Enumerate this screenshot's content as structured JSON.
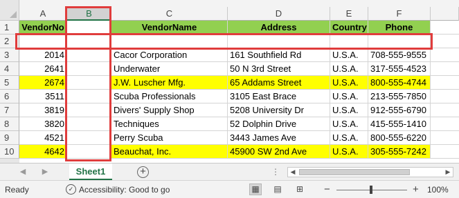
{
  "columns": [
    "A",
    "B",
    "C",
    "D",
    "E",
    "F"
  ],
  "rows": [
    "1",
    "2",
    "3",
    "4",
    "5",
    "6",
    "7",
    "8",
    "9",
    "10"
  ],
  "headers": [
    "VendorNo",
    "",
    "VendorName",
    "Address",
    "Country",
    "Phone"
  ],
  "data": [
    {
      "vendorNo": "2014",
      "name": "Cacor Corporation",
      "address": "161 Southfield Rd",
      "country": "U.S.A.",
      "phone": "708-555-9555",
      "highlight": false
    },
    {
      "vendorNo": "2641",
      "name": "Underwater",
      "address": "50 N 3rd Street",
      "country": "U.S.A.",
      "phone": "317-555-4523",
      "highlight": false
    },
    {
      "vendorNo": "2674",
      "name": "J.W.  Luscher Mfg.",
      "address": "65 Addams Street",
      "country": "U.S.A.",
      "phone": "800-555-4744",
      "highlight": true
    },
    {
      "vendorNo": "3511",
      "name": "Scuba Professionals",
      "address": "3105 East Brace",
      "country": "U.S.A.",
      "phone": "213-555-7850",
      "highlight": false
    },
    {
      "vendorNo": "3819",
      "name": "Divers'  Supply Shop",
      "address": "5208 University Dr",
      "country": "U.S.A.",
      "phone": "912-555-6790",
      "highlight": false
    },
    {
      "vendorNo": "3820",
      "name": "Techniques",
      "address": "52 Dolphin Drive",
      "country": "U.S.A.",
      "phone": "415-555-1410",
      "highlight": false
    },
    {
      "vendorNo": "4521",
      "name": "Perry Scuba",
      "address": "3443 James Ave",
      "country": "U.S.A.",
      "phone": "800-555-6220",
      "highlight": false
    },
    {
      "vendorNo": "4642",
      "name": "Beauchat, Inc.",
      "address": "45900 SW 2nd Ave",
      "country": "U.S.A.",
      "phone": "305-555-7242",
      "highlight": true
    }
  ],
  "colors": {
    "header_fill": "#92d050",
    "highlight_fill": "#ffff00",
    "annotation_box": "#e03c3c",
    "accent": "#217346"
  },
  "sheet_tab": "Sheet1",
  "status": {
    "ready": "Ready",
    "accessibility": "Accessibility: Good to go",
    "zoom": "100%"
  },
  "icons": {
    "add_sheet": "plus-circle-icon",
    "accessibility": "accessibility-icon",
    "normal_view": "grid-view-icon",
    "page_layout": "page-layout-icon",
    "page_break": "page-break-icon"
  }
}
